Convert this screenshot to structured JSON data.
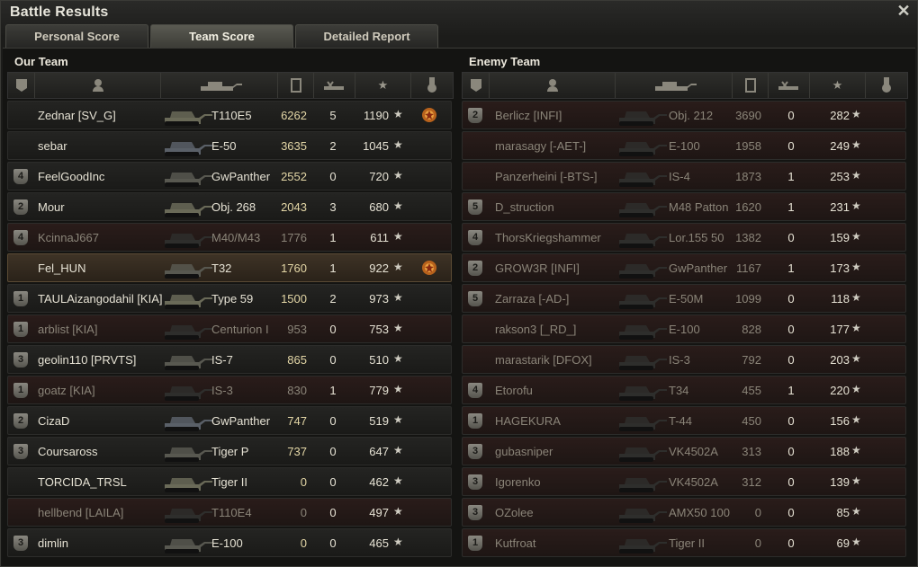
{
  "window": {
    "title": "Battle Results",
    "close_label": "✕"
  },
  "tabs": [
    "Personal Score",
    "Team Score",
    "Detailed Report"
  ],
  "our_team": {
    "title": "Our Team",
    "rows": [
      {
        "name": "Zednar [SV_G]",
        "vehicle": "T110E5",
        "damage": "6262",
        "kills": "5",
        "xp": "1190",
        "badge": "",
        "dead": false,
        "medal": true,
        "player": false
      },
      {
        "name": "sebar",
        "vehicle": "E-50",
        "damage": "3635",
        "kills": "2",
        "xp": "1045",
        "badge": "",
        "dead": false,
        "medal": false,
        "player": false
      },
      {
        "name": "FeelGoodInc",
        "vehicle": "GwPanther",
        "damage": "2552",
        "kills": "0",
        "xp": "720",
        "badge": "4",
        "dead": false,
        "medal": false,
        "player": false
      },
      {
        "name": "Mour",
        "vehicle": "Obj. 268",
        "damage": "2043",
        "kills": "3",
        "xp": "680",
        "badge": "2",
        "dead": false,
        "medal": false,
        "player": false
      },
      {
        "name": "KcinnaJ667",
        "vehicle": "M40/M43",
        "damage": "1776",
        "kills": "1",
        "xp": "611",
        "badge": "4",
        "dead": true,
        "medal": false,
        "player": false
      },
      {
        "name": "Fel_HUN",
        "vehicle": "T32",
        "damage": "1760",
        "kills": "1",
        "xp": "922",
        "badge": "",
        "dead": false,
        "medal": true,
        "player": true
      },
      {
        "name": "TAULAizangodahil [KIA]",
        "vehicle": "Type 59",
        "damage": "1500",
        "kills": "2",
        "xp": "973",
        "badge": "1",
        "dead": false,
        "medal": false,
        "player": false
      },
      {
        "name": "arblist [KIA]",
        "vehicle": "Centurion I",
        "damage": "953",
        "kills": "0",
        "xp": "753",
        "badge": "1",
        "dead": true,
        "medal": false,
        "player": false
      },
      {
        "name": "geolin110 [PRVTS]",
        "vehicle": "IS-7",
        "damage": "865",
        "kills": "0",
        "xp": "510",
        "badge": "3",
        "dead": false,
        "medal": false,
        "player": false
      },
      {
        "name": "goatz [KIA]",
        "vehicle": "IS-3",
        "damage": "830",
        "kills": "1",
        "xp": "779",
        "badge": "1",
        "dead": true,
        "medal": false,
        "player": false
      },
      {
        "name": "CizaD",
        "vehicle": "GwPanther",
        "damage": "747",
        "kills": "0",
        "xp": "519",
        "badge": "2",
        "dead": false,
        "medal": false,
        "player": false
      },
      {
        "name": "Coursaross",
        "vehicle": "Tiger P",
        "damage": "737",
        "kills": "0",
        "xp": "647",
        "badge": "3",
        "dead": false,
        "medal": false,
        "player": false
      },
      {
        "name": "TORCIDA_TRSL",
        "vehicle": "Tiger II",
        "damage": "0",
        "kills": "0",
        "xp": "462",
        "badge": "",
        "dead": false,
        "medal": false,
        "player": false
      },
      {
        "name": "hellbend [LAILA]",
        "vehicle": "T110E4",
        "damage": "0",
        "kills": "0",
        "xp": "497",
        "badge": "",
        "dead": true,
        "medal": false,
        "player": false
      },
      {
        "name": "dimlin",
        "vehicle": "E-100",
        "damage": "0",
        "kills": "0",
        "xp": "465",
        "badge": "3",
        "dead": false,
        "medal": false,
        "player": false
      }
    ]
  },
  "enemy_team": {
    "title": "Enemy Team",
    "rows": [
      {
        "name": "Berlicz [INFI]",
        "vehicle": "Obj. 212",
        "damage": "3690",
        "kills": "0",
        "xp": "282",
        "badge": "2",
        "dead": true
      },
      {
        "name": "marasagy [-AET-]",
        "vehicle": "E-100",
        "damage": "1958",
        "kills": "0",
        "xp": "249",
        "badge": "",
        "dead": true
      },
      {
        "name": "Panzerheini [-BTS-]",
        "vehicle": "IS-4",
        "damage": "1873",
        "kills": "1",
        "xp": "253",
        "badge": "",
        "dead": true
      },
      {
        "name": "D_struction",
        "vehicle": "M48 Patton",
        "damage": "1620",
        "kills": "1",
        "xp": "231",
        "badge": "5",
        "dead": true
      },
      {
        "name": "ThorsKriegshammer",
        "vehicle": "Lor.155 50",
        "damage": "1382",
        "kills": "0",
        "xp": "159",
        "badge": "4",
        "dead": true
      },
      {
        "name": "GROW3R [INFI]",
        "vehicle": "GwPanther",
        "damage": "1167",
        "kills": "1",
        "xp": "173",
        "badge": "2",
        "dead": true
      },
      {
        "name": "Zarraza [-AD-]",
        "vehicle": "E-50M",
        "damage": "1099",
        "kills": "0",
        "xp": "118",
        "badge": "5",
        "dead": true
      },
      {
        "name": "rakson3 [_RD_]",
        "vehicle": "E-100",
        "damage": "828",
        "kills": "0",
        "xp": "177",
        "badge": "",
        "dead": true
      },
      {
        "name": "marastarik [DFOX]",
        "vehicle": "IS-3",
        "damage": "792",
        "kills": "0",
        "xp": "203",
        "badge": "",
        "dead": true
      },
      {
        "name": "Etorofu",
        "vehicle": "T34",
        "damage": "455",
        "kills": "1",
        "xp": "220",
        "badge": "4",
        "dead": true
      },
      {
        "name": "HAGEKURA",
        "vehicle": "T-44",
        "damage": "450",
        "kills": "0",
        "xp": "156",
        "badge": "1",
        "dead": true
      },
      {
        "name": "gubasniper",
        "vehicle": "VK4502A",
        "damage": "313",
        "kills": "0",
        "xp": "188",
        "badge": "3",
        "dead": true
      },
      {
        "name": "Igorenko",
        "vehicle": "VK4502A",
        "damage": "312",
        "kills": "0",
        "xp": "139",
        "badge": "3",
        "dead": true
      },
      {
        "name": "OZolee",
        "vehicle": "AMX50 100",
        "damage": "0",
        "kills": "0",
        "xp": "85",
        "badge": "3",
        "dead": true
      },
      {
        "name": "Kutfroat",
        "vehicle": "Tiger II",
        "damage": "0",
        "kills": "0",
        "xp": "69",
        "badge": "1",
        "dead": true
      }
    ]
  },
  "icons": {
    "close": "close-icon",
    "badge": "class-badge-icon",
    "player": "player-icon",
    "tank": "tank-icon",
    "damage": "damage-icon",
    "kills": "kills-icon",
    "xp": "xp-star-icon",
    "medal": "medal-icon"
  },
  "colors": {
    "damage": "#e3d6a6",
    "dead_text": "#8a8478",
    "player_row": "#3e3326"
  }
}
